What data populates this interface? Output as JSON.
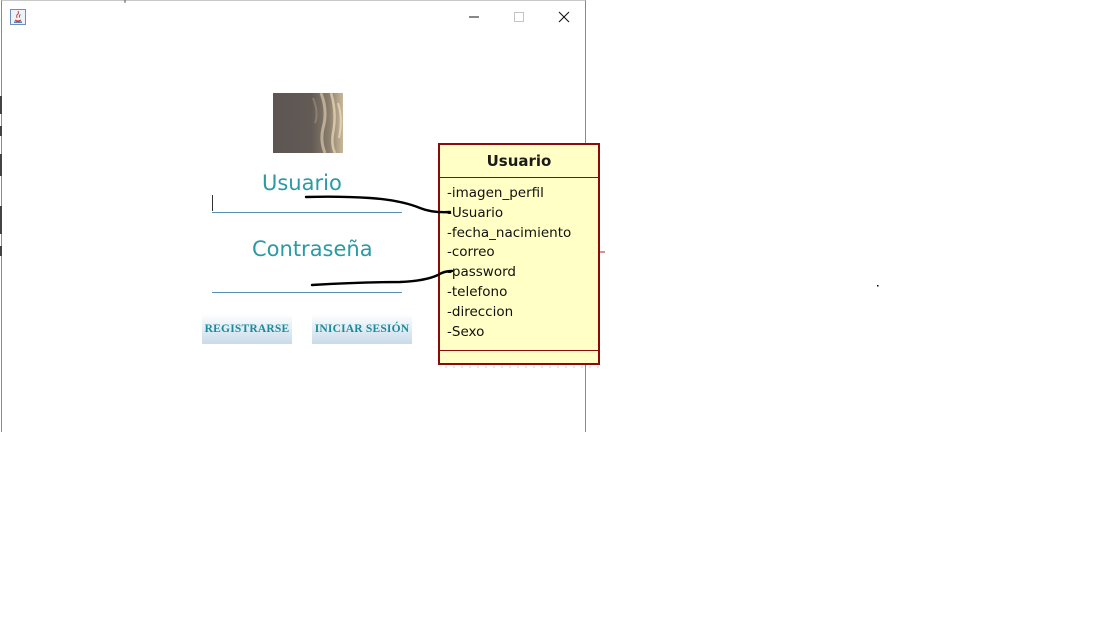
{
  "window": {
    "controls": {
      "minimize_icon": "minimize-icon",
      "maximize_icon": "maximize-icon",
      "close_icon": "close-icon"
    }
  },
  "login": {
    "usuario_label": "Usuario",
    "password_label": "Contraseña",
    "register_button": "REGISTRARSE",
    "login_button": "INICIAR SESIÓN"
  },
  "uml": {
    "class_name": "Usuario",
    "attributes": [
      "-imagen_perfil",
      "-Usuario",
      "-fecha_nacimiento",
      "-correo",
      "-password",
      "-telefono",
      "-direccion",
      "-Sexo"
    ]
  },
  "colors": {
    "label_teal": "#2a9aa5",
    "uml_fill": "#ffffc6",
    "uml_border": "#8b0a0a"
  }
}
